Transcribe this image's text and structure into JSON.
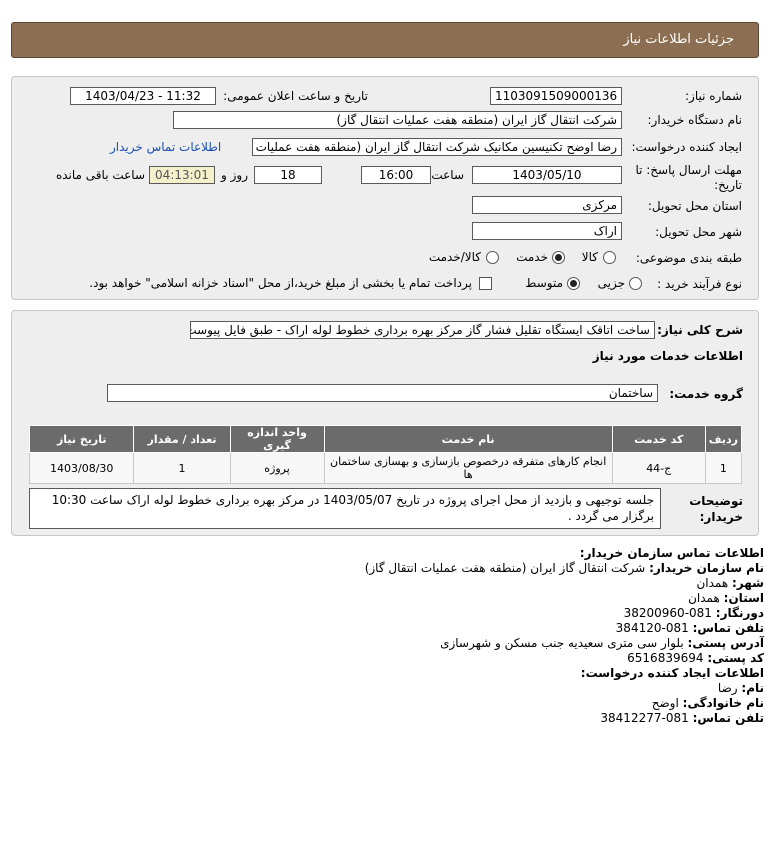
{
  "header": {
    "title": "جزئیات اطلاعات نیاز"
  },
  "labels": {
    "need_number": "شماره نیاز:",
    "announce_datetime": "تاریخ و ساعت اعلان عمومی:",
    "buyer_org": "نام دستگاه خریدار:",
    "creator": "ایجاد کننده درخواست:",
    "deadline_line1": "مهلت ارسال پاسخ: تا",
    "deadline_line2": "تاریخ:",
    "time_word": "ساعت",
    "days_and": "روز و",
    "remaining": "ساعت باقی مانده",
    "province": "استان محل تحویل:",
    "city": "شهر محل تحویل:",
    "category": "طبقه بندی موضوعی:",
    "process_type": "نوع فرآیند خرید :",
    "general_desc": "شرح کلی نیاز:",
    "services_info": "اطلاعات خدمات مورد نیاز",
    "service_group": "گروه خدمت:",
    "buyer_notes_1": "توضیحات",
    "buyer_notes_2": "خریدار:"
  },
  "form": {
    "need_number": "1103091509000136",
    "announce_datetime": "1403/04/23 - 11:32",
    "buyer_org": "شرکت انتقال گاز ایران (منطقه هفت عملیات انتقال گاز)",
    "creator": "رضا اوضح تکنیسین مکانیک شرکت انتقال گاز ایران (منطقه هفت عملیات انتقال گاز)",
    "contact_link": "اطلاعات تماس خریدار",
    "deadline_date": "1403/05/10",
    "deadline_time": "16:00",
    "days": "18",
    "remaining_time": "04:13:01",
    "province": "مرکزی",
    "city": "اراک",
    "category_options": [
      "کالا",
      "خدمت",
      "کالا/خدمت"
    ],
    "category_selected": "خدمت",
    "process_options": [
      "جزیی",
      "متوسط"
    ],
    "process_selected": "متوسط",
    "treasury_note": "پرداخت تمام یا بخشی از مبلغ خرید،از محل \"اسناد خزانه اسلامی\" خواهد بود.",
    "general_desc": "ساخت اتاقک ایستگاه تقلیل فشار گاز مرکز بهره برداری خطوط لوله اراک - طبق فایل پیوست",
    "service_group": "ساختمان",
    "buyer_notes": "جلسه توجیهی و بازدید از محل اجرای پروژه در تاریخ 1403/05/07 در مرکز بهره برداری خطوط لوله اراک ساعت 10:30 برگزار می گردد ."
  },
  "table": {
    "headers": [
      "ردیف",
      "کد خدمت",
      "نام خدمت",
      "واحد اندازه گیری",
      "تعداد / مقدار",
      "تاریخ نیاز"
    ],
    "rows": [
      {
        "row": "1",
        "code": "ج-44",
        "name": "انجام کارهای متفرقه درخصوص بازسازی و بهسازی ساختمان ها",
        "unit": "پروژه",
        "qty": "1",
        "date": "1403/08/30"
      }
    ]
  },
  "contact": {
    "heading": "اطلاعات تماس سازمان خریدار:",
    "buyer_name_label": "نام سازمان خریدار:",
    "buyer_name": "شرکت انتقال گاز ایران (منطقه هفت عملیات انتقال گاز)",
    "city_label": "شهر:",
    "city": "همدان",
    "province_label": "استان:",
    "province": "همدان",
    "fax_label": "دورنگار:",
    "fax": "081-38200960",
    "phone_label": "تلفن تماس:",
    "phone": "081-384120",
    "address_label": "آدرس پستی:",
    "address": "بلوار سی متری سعیدیه جنب مسکن و شهرسازی",
    "postal_label": "کد پستی:",
    "postal": "6516839694",
    "creator_heading": "اطلاعات ایجاد کننده درخواست:",
    "first_name_label": "نام:",
    "first_name": "رضا",
    "last_name_label": "نام خانوادگی:",
    "last_name": "اوضح",
    "creator_phone_label": "تلفن تماس:",
    "creator_phone": "081-38412277"
  }
}
